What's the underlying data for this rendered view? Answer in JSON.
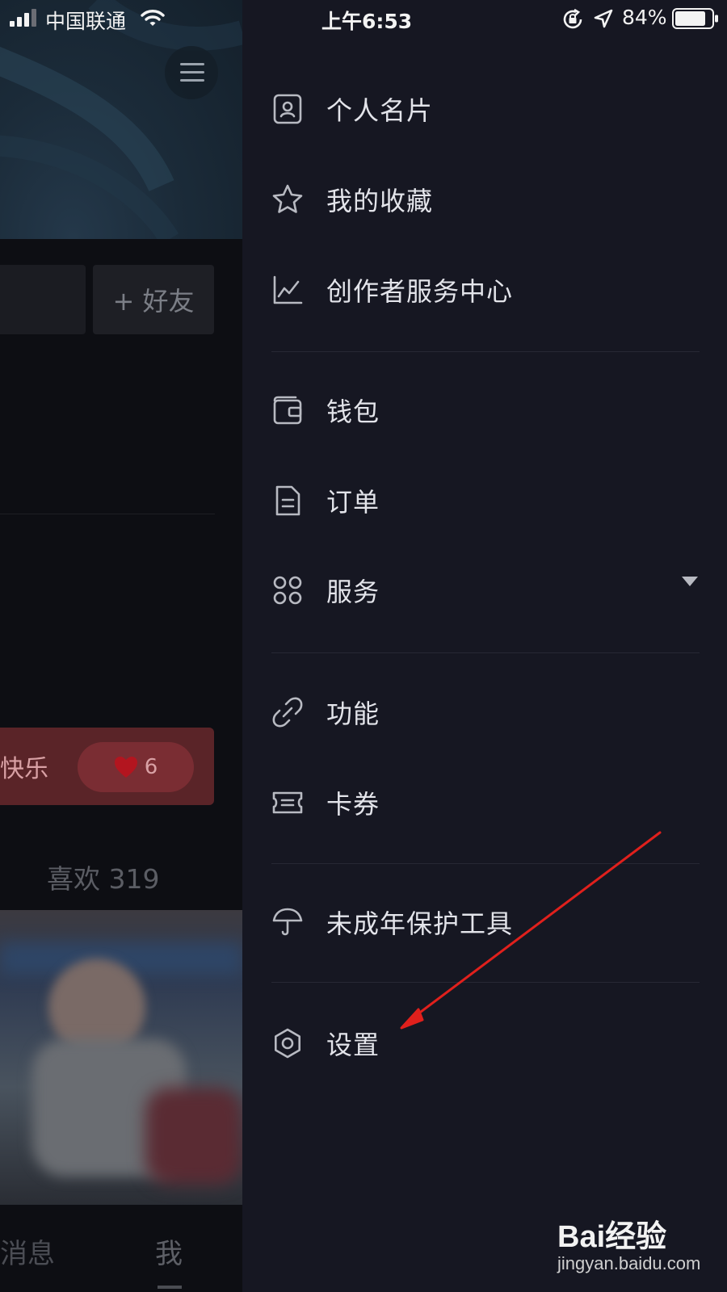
{
  "status_bar": {
    "carrier": "中国联通",
    "time": "上午6:53",
    "battery_percent": "84%"
  },
  "profile_background": {
    "add_friend_label": "+ 好友",
    "banner_text": "快乐",
    "banner_like_count": "6",
    "likes_label": "喜欢 319",
    "bottom_tabs": {
      "messages": "消息",
      "me": "我"
    }
  },
  "drawer": {
    "items": [
      {
        "label": "个人名片",
        "icon": "profile-card-icon"
      },
      {
        "label": "我的收藏",
        "icon": "star-icon"
      },
      {
        "label": "创作者服务中心",
        "icon": "chart-icon"
      },
      {
        "label": "钱包",
        "icon": "wallet-icon"
      },
      {
        "label": "订单",
        "icon": "order-document-icon"
      },
      {
        "label": "服务",
        "icon": "grid-services-icon",
        "expandable": true
      },
      {
        "label": "功能",
        "icon": "link-icon"
      },
      {
        "label": "卡券",
        "icon": "ticket-icon"
      },
      {
        "label": "未成年保护工具",
        "icon": "umbrella-icon"
      },
      {
        "label": "设置",
        "icon": "gear-icon"
      }
    ]
  },
  "annotation": {
    "color": "#e0201c"
  },
  "watermark": {
    "brand": "Bai经验",
    "url": "jingyan.baidu.com"
  }
}
